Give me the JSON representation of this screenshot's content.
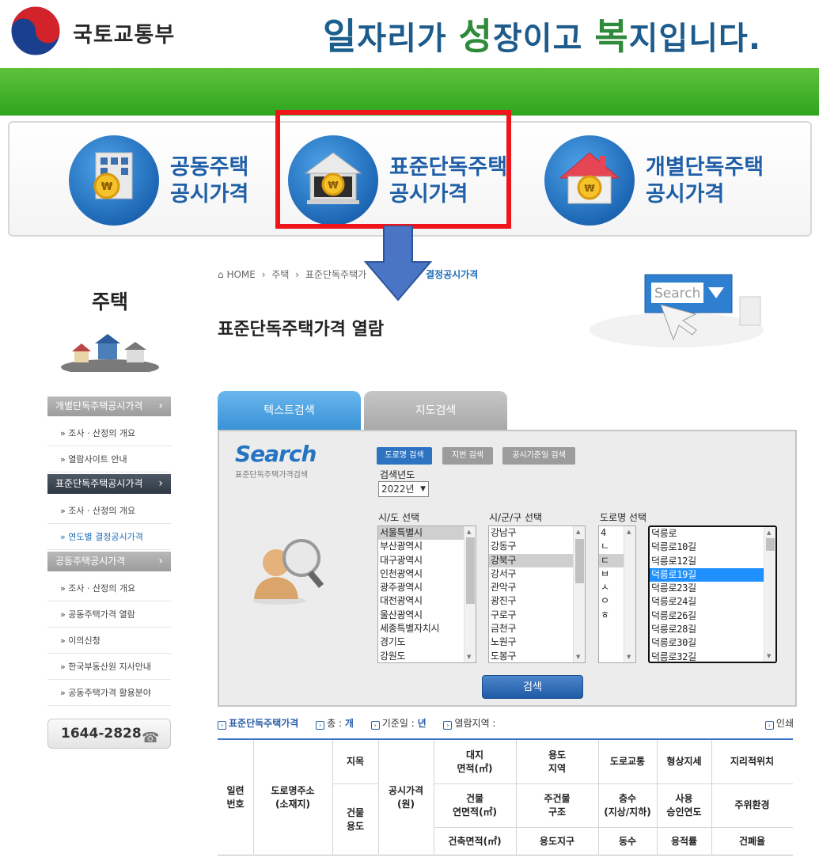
{
  "header": {
    "org_name": "국토교통부",
    "slogan_parts": [
      "일",
      "자리가 ",
      "성",
      "장이고 ",
      "복",
      "지입니다."
    ]
  },
  "cards": [
    {
      "line1": "공동주택",
      "line2": "공시가격"
    },
    {
      "line1": "표준단독주택",
      "line2": "공시가격"
    },
    {
      "line1": "개별단독주택",
      "line2": "공시가격"
    }
  ],
  "breadcrumb": {
    "home": "HOME",
    "level1": "주택",
    "level2": "표준단독주택가",
    "current": "결정공시가격"
  },
  "page_title": "표준단독주택가격 열람",
  "sidebar": {
    "title": "주택",
    "sections": [
      {
        "label": "개별단독주택공시가격",
        "items": [
          "조사 · 산정의 개요",
          "열람사이트 안내"
        ]
      },
      {
        "label": "표준단독주택공시가격",
        "items": [
          "조사 · 산정의 개요",
          "연도별 결정공시가격"
        ]
      },
      {
        "label": "공동주택공시가격",
        "items": [
          "조사 · 산정의 개요",
          "공동주택가격 열람",
          "이의신청",
          "한국부동산원 지사안내",
          "공동주택가격 활용분야"
        ]
      }
    ],
    "phone": "1644-2828"
  },
  "tabs": {
    "text_search": "텍스트검색",
    "map_search": "지도검색"
  },
  "search": {
    "logo": "Search",
    "subtitle": "표준단독주택가격검색",
    "buttons": {
      "road": "도로명 검색",
      "lot": "지번 검색",
      "date": "공시기준일 검색"
    },
    "year_label": "검색년도",
    "year_value": "2022년",
    "sido_label": "시/도 선택",
    "sigungu_label": "시/군/구 선택",
    "road_label": "도로명 선택",
    "sido_list": [
      "서울특별시",
      "부산광역시",
      "대구광역시",
      "인천광역시",
      "광주광역시",
      "대전광역시",
      "울산광역시",
      "세종특별자치시",
      "경기도",
      "강원도"
    ],
    "sigungu_list": [
      "강남구",
      "강동구",
      "강북구",
      "강서구",
      "관악구",
      "광진구",
      "구로구",
      "금천구",
      "노원구",
      "도봉구"
    ],
    "initial_list": [
      "4",
      "ㄴ",
      "ㄷ",
      "ㅂ",
      "ㅅ",
      "ㅇ",
      "ㅎ"
    ],
    "road_list": [
      "덕릉로",
      "덕릉로10길",
      "덕릉로12길",
      "덕릉로19길",
      "덕릉로23길",
      "덕릉로24길",
      "덕릉로26길",
      "덕릉로28길",
      "덕릉로30길",
      "덕릉로32길"
    ],
    "go": "검색"
  },
  "info_bar": {
    "section": "표준단독주택가격",
    "total_label": "총 :",
    "total_unit": "개",
    "base_label": "기준일 :",
    "base_unit": "년",
    "region_label": "열람지역 :",
    "print": "인쇄"
  },
  "table": {
    "serial": "일련\n번호",
    "address": "도로명주소\n(소재지)",
    "jimok": "지목",
    "bldg_use": "건물\n용도",
    "price": "공시가격\n(원)",
    "land_area": "대지\n면적(㎡)",
    "use_area": "용도\n지역",
    "road": "도로교통",
    "shape": "형상지세",
    "geo": "지리적위치",
    "bldg_area": "건물\n연면적(㎡)",
    "structure": "주건물\n구조",
    "floors": "층수\n(지상/지하)",
    "approval": "사용\n승인연도",
    "environment": "주위환경",
    "footprint": "건축면적(㎡)",
    "district": "용도지구",
    "count": "동수",
    "far": "용적률",
    "bcr": "건폐율"
  }
}
